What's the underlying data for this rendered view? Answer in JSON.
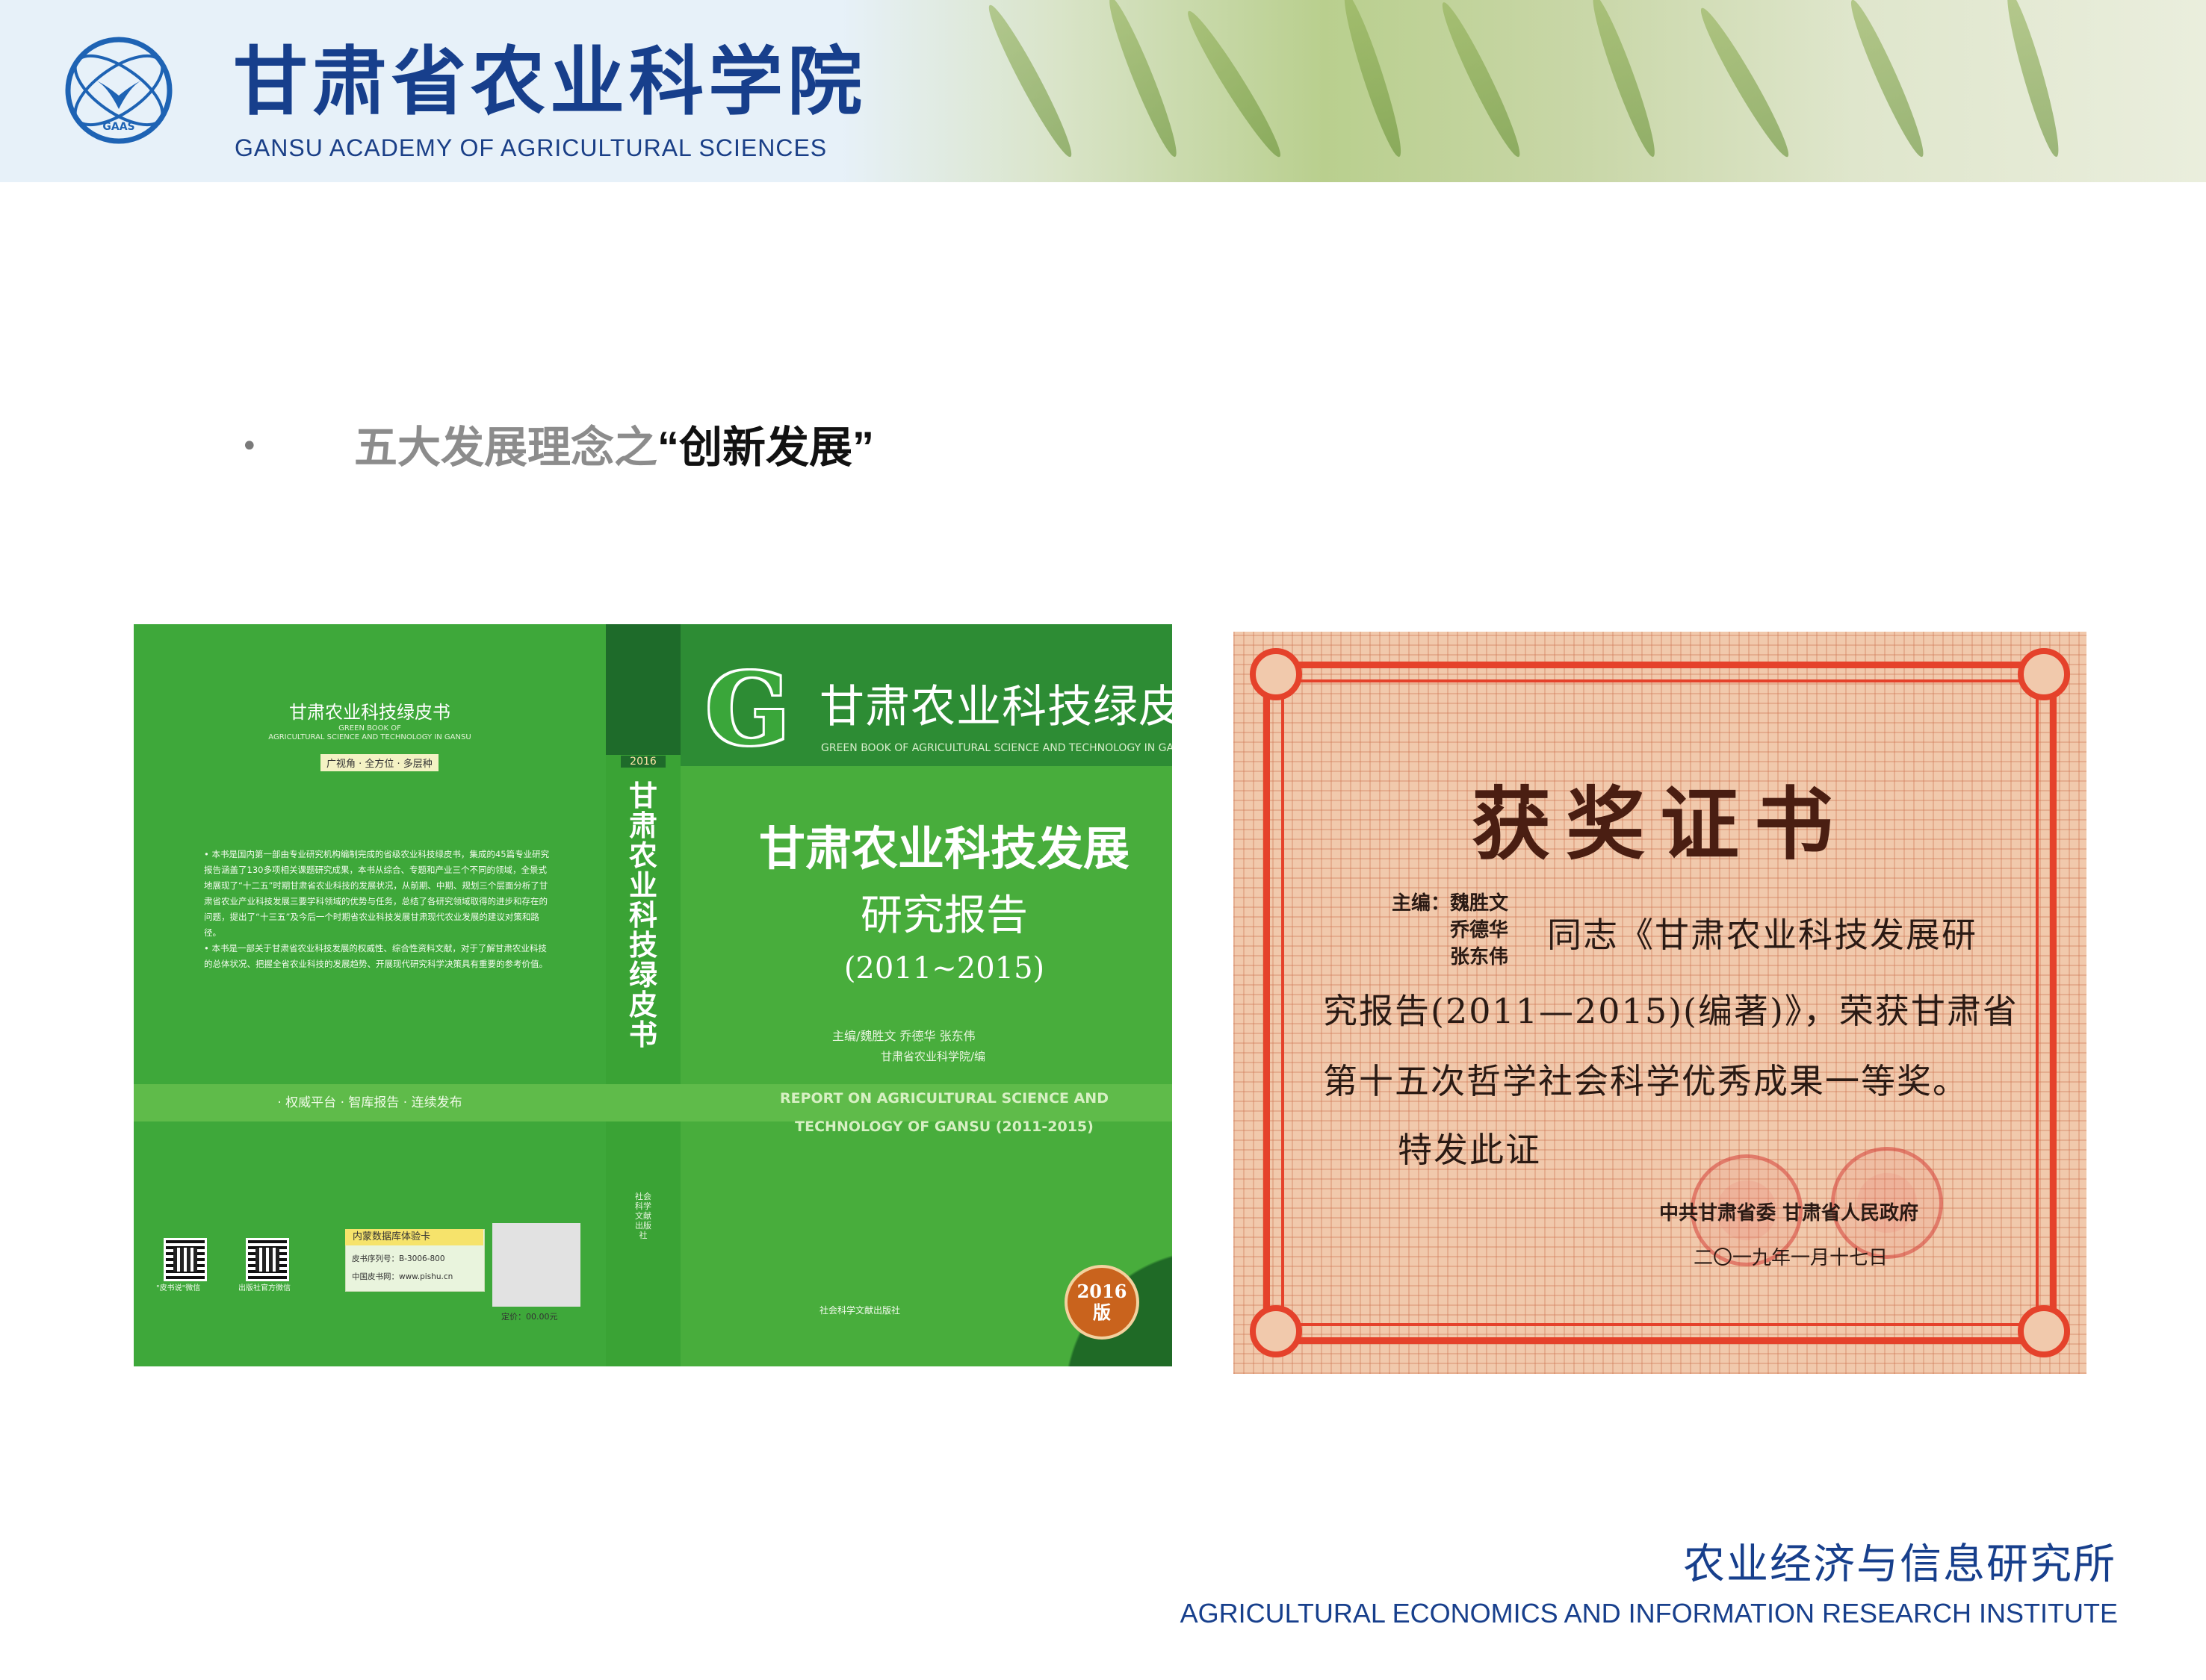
{
  "header": {
    "org_name_cn": "甘肃省农业科学院",
    "org_name_en": "GANSU ACADEMY OF AGRICULTURAL SCIENCES",
    "logo_text": "GAAS",
    "logo_color": "#1e63b4"
  },
  "heading": {
    "bullet": "•",
    "prefix": "五大发展理念之",
    "emphasis": "“创新发展”"
  },
  "book": {
    "series_cn": "甘肃农业科技绿皮书",
    "series_en": "GREEN BOOK OF AGRICULTURAL SCIENCE AND TECHNOLOGY IN GANSU",
    "series_letter": "G",
    "title": "甘肃农业科技发展",
    "subtitle": "研究报告",
    "years": "(2011~2015)",
    "editors": "主编/魏胜文  乔德华  张东伟",
    "publisher_line": "甘肃省农业科学院/编",
    "en_title_1": "REPORT ON AGRICULTURAL SCIENCE AND",
    "en_title_2": "TECHNOLOGY OF GANSU (2011-2015)",
    "spine_year": "2016",
    "spine_title": "甘肃农业科技绿皮书",
    "spine_press": "社会科学文献出版社",
    "back_series": "甘肃农业科技绿皮书",
    "back_series_en_1": "GREEN BOOK OF",
    "back_series_en_2": "AGRICULTURAL SCIENCE AND TECHNOLOGY IN GANSU",
    "back_tags": "广视角 · 全方位 · 多层种",
    "back_blurb": "• 本书是国内第一部由专业研究机构编制完成的省级农业科技绿皮书，集成的45篇专业研究报告涵盖了130多项相关课题研究成果，本书从综合、专题和产业三个不同的领域，全景式地展现了“十二五”时期甘肃省农业科技的发展状况，从前期、中期、规划三个层面分析了甘肃省农业产业科技发展三要学科领域的优势与任务，总结了各研究领域取得的进步和存在的问题，提出了“十三五”及今后一个时期省农业科技发展甘肃现代农业发展的建议对策和路径。\n• 本书是一部关于甘肃省农业科技发展的权威性、综合性资料文献，对于了解甘肃农业科技的总体状况、把握全省农业科技的发展趋势、开展现代研究科学决策具有重要的参考价值。",
    "back_slogan": "· 权威平台 · 智库报告 · 连续发布",
    "qr1_caption": "\"皮书说\"微信",
    "qr2_caption": "出版社官方微信",
    "card_header": "内蒙数据库体验卡",
    "card_line_1": "皮书序列号：B-3006-800",
    "card_line_2": "中国皮书网：www.pishu.cn",
    "price": "定价：00.00元",
    "publisher_logo_text": "社会科学文献出版社",
    "badge_line_1": "2016",
    "badge_line_2": "版",
    "cover_color": "#3aa63a"
  },
  "certificate": {
    "title": "获奖证书",
    "editors_label": "主编：",
    "editors": [
      "魏胜文",
      "乔德华",
      "张东伟"
    ],
    "line_1": "同志《甘肃农业科技发展研",
    "line_2": "究报告(2011—2015)(编著)》，荣获甘肃省",
    "line_3": "第十五次哲学社会科学优秀成果一等奖。",
    "line_4": "特发此证",
    "issuer": "中共甘肃省委    甘肃省人民政府",
    "date": "二〇一九年一月十七日",
    "frame_color": "#e5422b"
  },
  "footer": {
    "institute_cn": "农业经济与信息研究所",
    "institute_en": "AGRICULTURAL ECONOMICS AND INFORMATION RESEARCH INSTITUTE"
  }
}
